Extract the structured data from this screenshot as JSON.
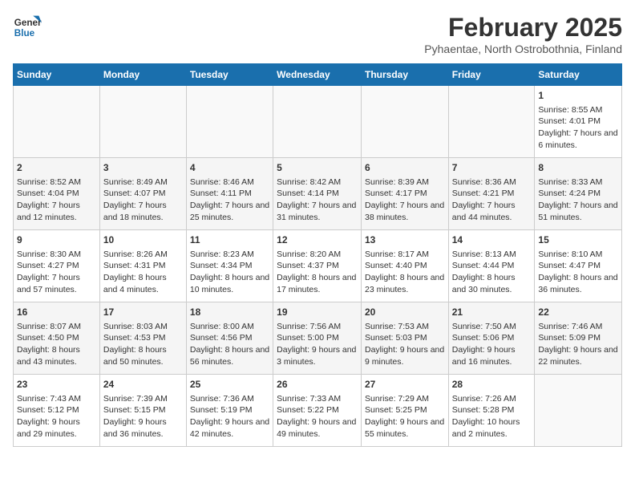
{
  "header": {
    "logo_line1": "General",
    "logo_line2": "Blue",
    "title": "February 2025",
    "subtitle": "Pyhaentae, North Ostrobothnia, Finland"
  },
  "weekdays": [
    "Sunday",
    "Monday",
    "Tuesday",
    "Wednesday",
    "Thursday",
    "Friday",
    "Saturday"
  ],
  "weeks": [
    [
      {
        "day": "",
        "text": ""
      },
      {
        "day": "",
        "text": ""
      },
      {
        "day": "",
        "text": ""
      },
      {
        "day": "",
        "text": ""
      },
      {
        "day": "",
        "text": ""
      },
      {
        "day": "",
        "text": ""
      },
      {
        "day": "1",
        "text": "Sunrise: 8:55 AM\nSunset: 4:01 PM\nDaylight: 7 hours and 6 minutes."
      }
    ],
    [
      {
        "day": "2",
        "text": "Sunrise: 8:52 AM\nSunset: 4:04 PM\nDaylight: 7 hours and 12 minutes."
      },
      {
        "day": "3",
        "text": "Sunrise: 8:49 AM\nSunset: 4:07 PM\nDaylight: 7 hours and 18 minutes."
      },
      {
        "day": "4",
        "text": "Sunrise: 8:46 AM\nSunset: 4:11 PM\nDaylight: 7 hours and 25 minutes."
      },
      {
        "day": "5",
        "text": "Sunrise: 8:42 AM\nSunset: 4:14 PM\nDaylight: 7 hours and 31 minutes."
      },
      {
        "day": "6",
        "text": "Sunrise: 8:39 AM\nSunset: 4:17 PM\nDaylight: 7 hours and 38 minutes."
      },
      {
        "day": "7",
        "text": "Sunrise: 8:36 AM\nSunset: 4:21 PM\nDaylight: 7 hours and 44 minutes."
      },
      {
        "day": "8",
        "text": "Sunrise: 8:33 AM\nSunset: 4:24 PM\nDaylight: 7 hours and 51 minutes."
      }
    ],
    [
      {
        "day": "9",
        "text": "Sunrise: 8:30 AM\nSunset: 4:27 PM\nDaylight: 7 hours and 57 minutes."
      },
      {
        "day": "10",
        "text": "Sunrise: 8:26 AM\nSunset: 4:31 PM\nDaylight: 8 hours and 4 minutes."
      },
      {
        "day": "11",
        "text": "Sunrise: 8:23 AM\nSunset: 4:34 PM\nDaylight: 8 hours and 10 minutes."
      },
      {
        "day": "12",
        "text": "Sunrise: 8:20 AM\nSunset: 4:37 PM\nDaylight: 8 hours and 17 minutes."
      },
      {
        "day": "13",
        "text": "Sunrise: 8:17 AM\nSunset: 4:40 PM\nDaylight: 8 hours and 23 minutes."
      },
      {
        "day": "14",
        "text": "Sunrise: 8:13 AM\nSunset: 4:44 PM\nDaylight: 8 hours and 30 minutes."
      },
      {
        "day": "15",
        "text": "Sunrise: 8:10 AM\nSunset: 4:47 PM\nDaylight: 8 hours and 36 minutes."
      }
    ],
    [
      {
        "day": "16",
        "text": "Sunrise: 8:07 AM\nSunset: 4:50 PM\nDaylight: 8 hours and 43 minutes."
      },
      {
        "day": "17",
        "text": "Sunrise: 8:03 AM\nSunset: 4:53 PM\nDaylight: 8 hours and 50 minutes."
      },
      {
        "day": "18",
        "text": "Sunrise: 8:00 AM\nSunset: 4:56 PM\nDaylight: 8 hours and 56 minutes."
      },
      {
        "day": "19",
        "text": "Sunrise: 7:56 AM\nSunset: 5:00 PM\nDaylight: 9 hours and 3 minutes."
      },
      {
        "day": "20",
        "text": "Sunrise: 7:53 AM\nSunset: 5:03 PM\nDaylight: 9 hours and 9 minutes."
      },
      {
        "day": "21",
        "text": "Sunrise: 7:50 AM\nSunset: 5:06 PM\nDaylight: 9 hours and 16 minutes."
      },
      {
        "day": "22",
        "text": "Sunrise: 7:46 AM\nSunset: 5:09 PM\nDaylight: 9 hours and 22 minutes."
      }
    ],
    [
      {
        "day": "23",
        "text": "Sunrise: 7:43 AM\nSunset: 5:12 PM\nDaylight: 9 hours and 29 minutes."
      },
      {
        "day": "24",
        "text": "Sunrise: 7:39 AM\nSunset: 5:15 PM\nDaylight: 9 hours and 36 minutes."
      },
      {
        "day": "25",
        "text": "Sunrise: 7:36 AM\nSunset: 5:19 PM\nDaylight: 9 hours and 42 minutes."
      },
      {
        "day": "26",
        "text": "Sunrise: 7:33 AM\nSunset: 5:22 PM\nDaylight: 9 hours and 49 minutes."
      },
      {
        "day": "27",
        "text": "Sunrise: 7:29 AM\nSunset: 5:25 PM\nDaylight: 9 hours and 55 minutes."
      },
      {
        "day": "28",
        "text": "Sunrise: 7:26 AM\nSunset: 5:28 PM\nDaylight: 10 hours and 2 minutes."
      },
      {
        "day": "",
        "text": ""
      }
    ]
  ]
}
